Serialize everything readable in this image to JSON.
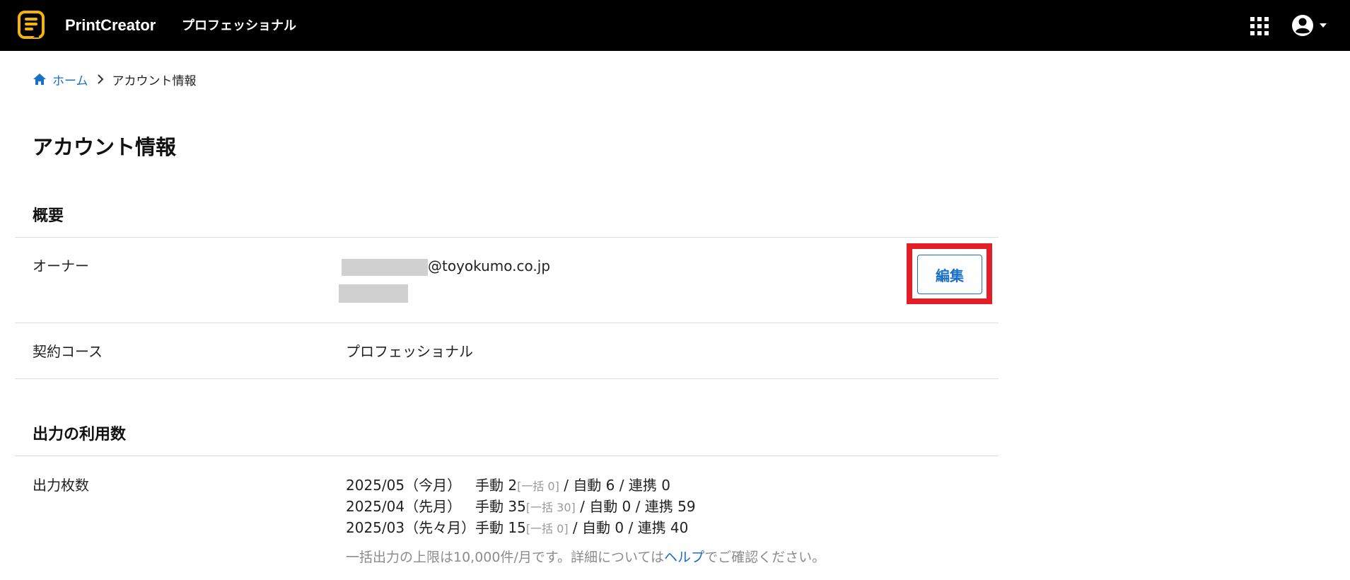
{
  "header": {
    "brand": "PrintCreator",
    "plan": "プロフェッショナル",
    "colors": {
      "background": "#000000",
      "logo": "#f5b400"
    }
  },
  "breadcrumb": {
    "home": "ホーム",
    "current": "アカウント情報"
  },
  "page_title": "アカウント情報",
  "overview": {
    "title": "概要",
    "owner_label": "オーナー",
    "owner_email_domain": "@toyokumo.co.jp",
    "edit_label": "編集",
    "course_label": "契約コース",
    "course_value": "プロフェッショナル"
  },
  "usage": {
    "title": "出力の利用数",
    "row_label": "出力枚数",
    "rows": [
      {
        "month": "2025/05（今月）",
        "manual": "手動 2",
        "bulk": "[一括 0]",
        "rest": " / 自動 6 / 連携 0"
      },
      {
        "month": "2025/04（先月）",
        "manual": "手動 35",
        "bulk": "[一括 30]",
        "rest": " / 自動 0 / 連携 59"
      },
      {
        "month": "2025/03（先々月）",
        "manual": "手動 15",
        "bulk": "[一括 0]",
        "rest": " / 自動 0 / 連携 40"
      }
    ],
    "note_before": "一括出力の上限は10,000件/月です。詳細については",
    "note_link": "ヘルプ",
    "note_after": "でご確認ください。"
  },
  "accent_color": "#1a6fc9",
  "highlight_color": "#e41e26"
}
